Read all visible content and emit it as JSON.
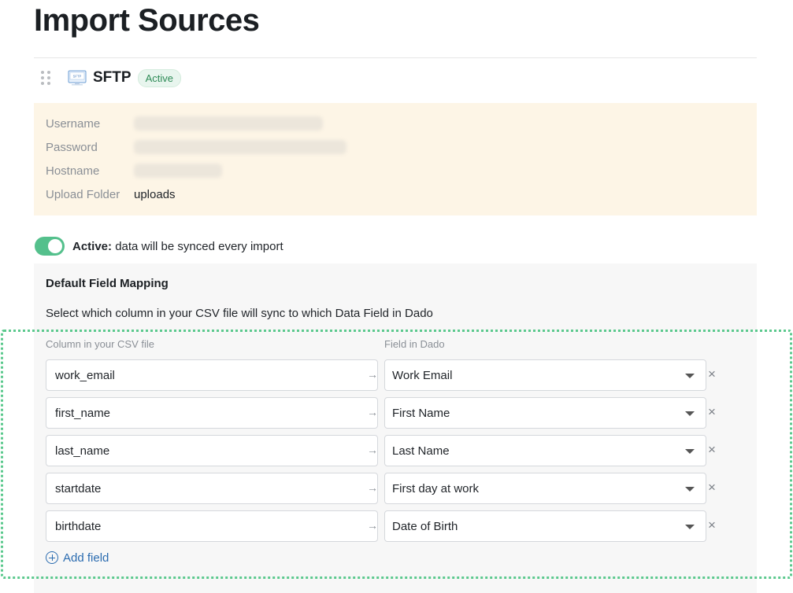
{
  "page": {
    "title": "Import Sources"
  },
  "source": {
    "name": "SFTP",
    "icon_text": "SFTP",
    "status_badge": "Active",
    "credentials": [
      {
        "label": "Username",
        "value": "",
        "blurred": true
      },
      {
        "label": "Password",
        "value": "",
        "blurred": true
      },
      {
        "label": "Hostname",
        "value": "",
        "blurred": true
      },
      {
        "label": "Upload Folder",
        "value": "uploads",
        "blurred": false
      }
    ]
  },
  "sync_toggle": {
    "on": true,
    "label_bold": "Active:",
    "label_rest": " data will be synced every import"
  },
  "mapping": {
    "title": "Default Field Mapping",
    "description": "Select which column in your CSV file will sync to which Data Field in Dado",
    "csv_column_header": "Column in your CSV file",
    "field_column_header": "Field in Dado",
    "rows": [
      {
        "csv": "work_email",
        "field": "Work Email"
      },
      {
        "csv": "first_name",
        "field": "First Name"
      },
      {
        "csv": "last_name",
        "field": "Last Name"
      },
      {
        "csv": "startdate",
        "field": "First day at work"
      },
      {
        "csv": "birthdate",
        "field": "Date of Birth"
      }
    ],
    "arrow_glyph": "→",
    "remove_glyph": "×",
    "add_field_label": "Add field"
  },
  "colors": {
    "accent_green": "#54c08c",
    "highlight_border": "#5cc98e",
    "credentials_bg": "#fdf5e6",
    "link_blue": "#2b6cb0"
  }
}
